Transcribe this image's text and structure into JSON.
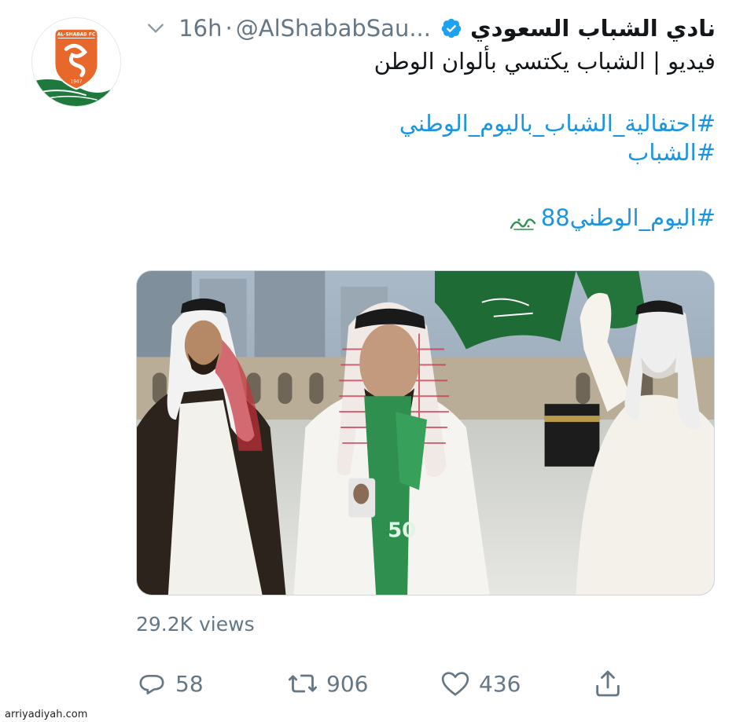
{
  "account": {
    "name": "نادي الشباب السعودي",
    "handle": "@AlShababSau...",
    "separator": "·",
    "time": "16h",
    "avatar_logo_text": "AL-SHABAB FC",
    "avatar_logo_year": "1947"
  },
  "tweet": {
    "text": "فيديو | الشباب يكتسي بألوان الوطن",
    "hashtags": [
      "#احتفالية_الشباب_باليوم_الوطني",
      "#الشباب",
      "#اليوم_الوطني88"
    ]
  },
  "media": {
    "type": "video"
  },
  "stats": {
    "views": "29.2K views",
    "replies": "58",
    "retweets": "906",
    "likes": "436"
  },
  "icons": {
    "verified": "verified-badge-icon",
    "chevron": "chevron-down-icon",
    "reply": "reply-icon",
    "retweet": "retweet-icon",
    "like": "heart-icon",
    "share": "share-icon"
  },
  "colors": {
    "link": "#1b95e0",
    "secondary_text": "#657786",
    "primary_text": "#14171a",
    "logo_orange": "#e8672a",
    "flag_green": "#1d7a3c"
  },
  "watermark": "arriyadiyah.com"
}
